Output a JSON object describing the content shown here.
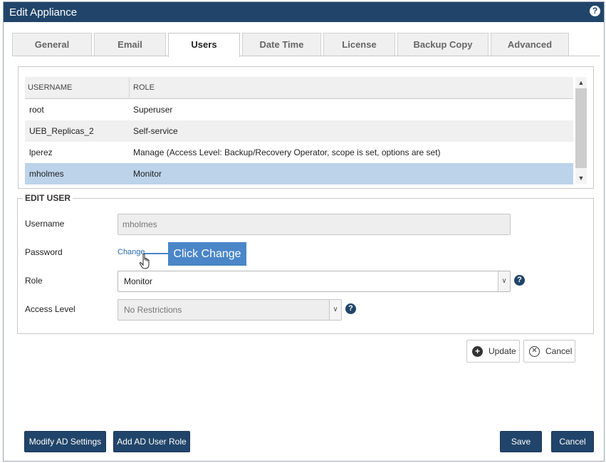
{
  "window": {
    "title": "Edit Appliance"
  },
  "tabs": [
    {
      "label": "General"
    },
    {
      "label": "Email"
    },
    {
      "label": "Users"
    },
    {
      "label": "Date Time"
    },
    {
      "label": "License"
    },
    {
      "label": "Backup Copy"
    },
    {
      "label": "Advanced"
    }
  ],
  "active_tab": "Users",
  "users_table": {
    "columns": [
      "USERNAME",
      "ROLE"
    ],
    "rows": [
      {
        "username": "root",
        "role": "Superuser"
      },
      {
        "username": "UEB_Replicas_2",
        "role": "Self-service"
      },
      {
        "username": "lperez",
        "role": "Manage (Access Level: Backup/Recovery Operator, scope is set, options are set)"
      },
      {
        "username": "mholmes",
        "role": "Monitor"
      }
    ],
    "selected_row": 3
  },
  "edit_user": {
    "legend": "EDIT USER",
    "username_label": "Username",
    "username_value": "mholmes",
    "password_label": "Password",
    "change_link": "Change",
    "callout_text": "Click Change",
    "role_label": "Role",
    "role_value": "Monitor",
    "access_level_label": "Access Level",
    "access_level_value": "No Restrictions"
  },
  "actions": {
    "update_label": "Update",
    "cancel_label": "Cancel"
  },
  "footer": {
    "modify_ad_label": "Modify AD Settings",
    "add_ad_role_label": "Add AD User Role",
    "save_label": "Save",
    "cancel_label": "Cancel"
  },
  "icons": {
    "help": "help-icon",
    "plus": "plus-circle-icon",
    "cancel": "x-circle-icon",
    "caret": "chevron-down-icon",
    "cursor": "hand-pointer-icon"
  },
  "colors": {
    "titlebar": "#21456a",
    "selected_row": "#bcd3ea",
    "callout": "#4a86c8",
    "primary_button": "#21456a"
  }
}
